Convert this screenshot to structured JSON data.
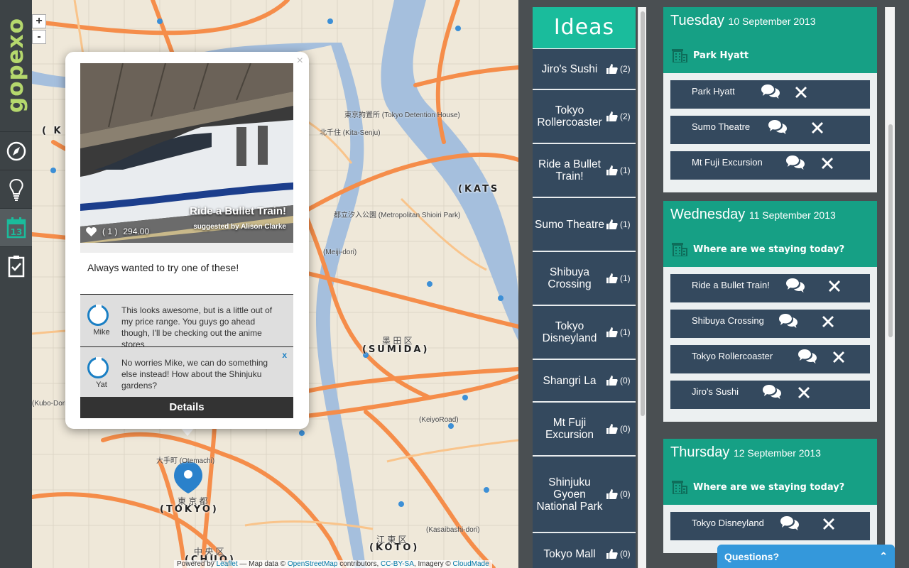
{
  "app": {
    "logo": "gopexo"
  },
  "rail": [
    {
      "name": "explore",
      "icon": "compass-icon"
    },
    {
      "name": "ideas",
      "icon": "lightbulb-icon"
    },
    {
      "name": "calendar",
      "icon": "calendar-icon",
      "label": "13",
      "active": true
    },
    {
      "name": "checklist",
      "icon": "clipboard-check-icon"
    }
  ],
  "map": {
    "zoom_in": "+",
    "zoom_out": "-",
    "labels": {
      "sumida": "(SUMIDA)",
      "sumida_jp": "墨 田 区",
      "tokyo": "(TOKYO)",
      "tokyo_jp": "東 京 都",
      "koto": "(KOTO)",
      "koto_jp": "江 東 区",
      "chuo": "(CHUO)",
      "chuo_jp": "中 央 区",
      "kats": "(KATS",
      "k_left": "( K",
      "detention": "東京拘置所 (Tokyo Detention House)",
      "park": "都立汐入公園 (Metropolitan Shioiri Park)",
      "kitasenju": "北千住 (Kita-Senju)",
      "otemachi": "大手町 (Otemachi)",
      "keiyo": "(KeiyoRoad)",
      "kasai": "(Kasaibashi-dori)",
      "meiji": "(Meiji-dori)",
      "kubo": "(Kubo-Dori)"
    },
    "attribution": {
      "prefix": "Powered by",
      "leaflet": "Leaflet",
      "mid": "— Map data ©",
      "osm": "OpenStreetMap",
      "tail": "contributors,",
      "license": "CC-BY-SA",
      "imagery": ", Imagery ©",
      "cloudmade": "CloudMade"
    }
  },
  "popup": {
    "close": "×",
    "title": "Ride a Bullet Train!",
    "suggested_by": "suggested by Alison Clarke",
    "likes": "( 1 )",
    "price": "294.00",
    "description": "Always wanted to try one of these!",
    "comments": [
      {
        "author": "Mike",
        "text": "This looks awesome, but is a little out of my price range. You guys go ahead though, I'll be checking out the anime stores",
        "delete": ""
      },
      {
        "author": "Yat",
        "text": "No worries Mike, we can do something else instead! How about the Shinjuku gardens?",
        "delete": "x"
      }
    ],
    "details_button": "Details"
  },
  "ideas": {
    "title": "Ideas",
    "items": [
      {
        "name": "Jiro's Sushi",
        "likes": "(2)"
      },
      {
        "name": "Tokyo Rollercoaster",
        "likes": "(2)"
      },
      {
        "name": "Ride a Bullet Train!",
        "likes": "(1)"
      },
      {
        "name": "Sumo Theatre",
        "likes": "(1)"
      },
      {
        "name": "Shibuya Crossing",
        "likes": "(1)"
      },
      {
        "name": "Tokyo Disneyland",
        "likes": "(1)"
      },
      {
        "name": "Shangri La",
        "likes": "(0)"
      },
      {
        "name": "Mt Fuji Excursion",
        "likes": "(0)"
      },
      {
        "name": "Shinjuku Gyoen National Park",
        "likes": "(0)"
      },
      {
        "name": "Tokyo Mall",
        "likes": "(0)"
      }
    ]
  },
  "itinerary": [
    {
      "day": "Tuesday",
      "date": "10 September 2013",
      "stay": "Park Hyatt",
      "activities": [
        "Park Hyatt",
        "Sumo Theatre",
        "Mt Fuji Excursion"
      ]
    },
    {
      "day": "Wednesday",
      "date": "11 September 2013",
      "stay": "Where are we staying today?",
      "activities": [
        "Ride a Bullet Train!",
        "Shibuya Crossing",
        "Tokyo Rollercoaster",
        "Jiro's Sushi"
      ]
    },
    {
      "day": "Thursday",
      "date": "12 September 2013",
      "stay": "Where are we staying today?",
      "activities": [
        "Tokyo Disneyland"
      ]
    }
  ],
  "questions": {
    "label": "Questions?",
    "toggle": "⌃"
  },
  "colors": {
    "teal": "#1abc9c",
    "dark_teal": "#16a085",
    "navy": "#34495e",
    "blue": "#3498db",
    "logo_green": "#b5d86d"
  }
}
